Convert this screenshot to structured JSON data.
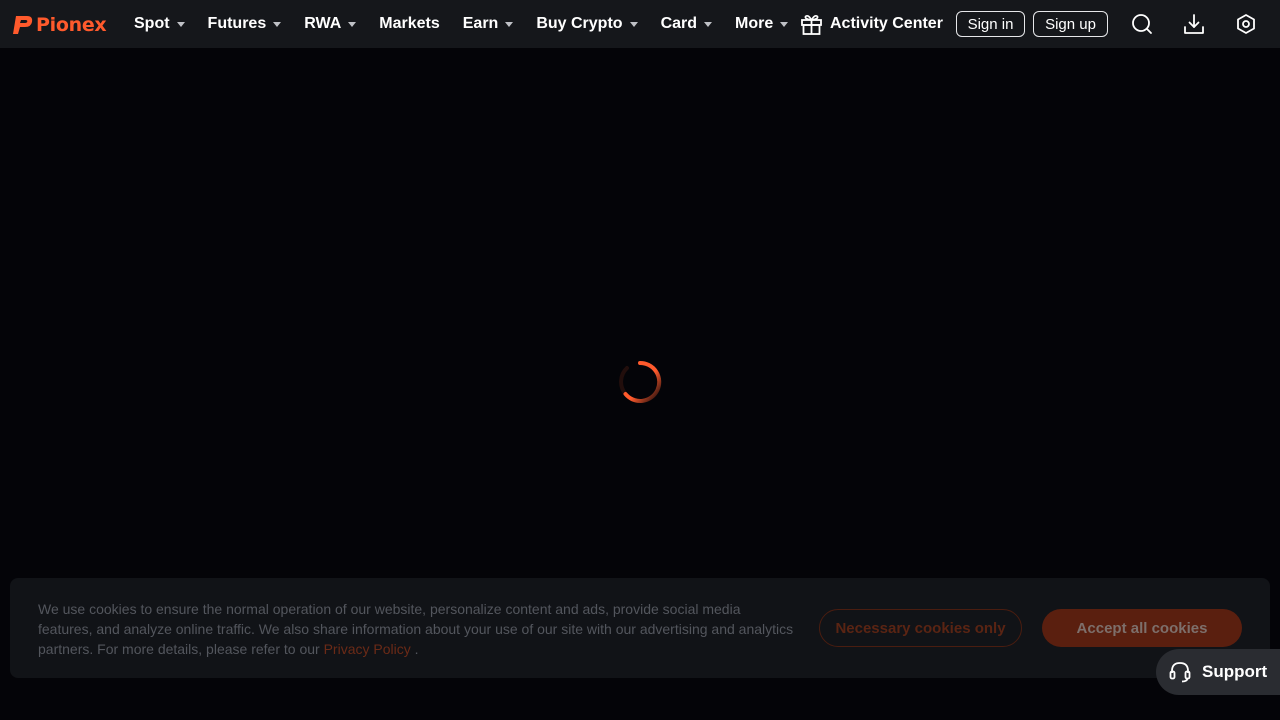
{
  "brand": {
    "name": "Pionex",
    "color": "#ff5a2c"
  },
  "nav": {
    "items": [
      {
        "label": "Spot",
        "dropdown": true
      },
      {
        "label": "Futures",
        "dropdown": true
      },
      {
        "label": "RWA",
        "dropdown": true
      },
      {
        "label": "Markets",
        "dropdown": false
      },
      {
        "label": "Earn",
        "dropdown": true
      },
      {
        "label": "Buy Crypto",
        "dropdown": true
      },
      {
        "label": "Card",
        "dropdown": true
      },
      {
        "label": "More",
        "dropdown": true
      }
    ],
    "activity_label": "Activity Center",
    "activity_icon": "gift-icon",
    "signin_label": "Sign in",
    "signup_label": "Sign up",
    "icons": [
      "search-icon",
      "download-icon",
      "settings-icon"
    ]
  },
  "loading": {
    "icon": "loading-spinner",
    "color": "#ff5a2c"
  },
  "cookie": {
    "text_before": "We use cookies to ensure the normal operation of our website, personalize content and ads, provide social media features, and analyze online traffic. We also share information about your use of our site with our advertising and analytics partners. For more details, please refer to our",
    "link_label": "Privacy Policy",
    "text_after": ".",
    "necessary_label": "Necessary cookies only",
    "accept_label": "Accept all cookies"
  },
  "support": {
    "label": "Support",
    "icon": "headset-icon"
  },
  "colors": {
    "background": "#040408",
    "navbar": "#15171b",
    "accent": "#ff5a2c"
  }
}
